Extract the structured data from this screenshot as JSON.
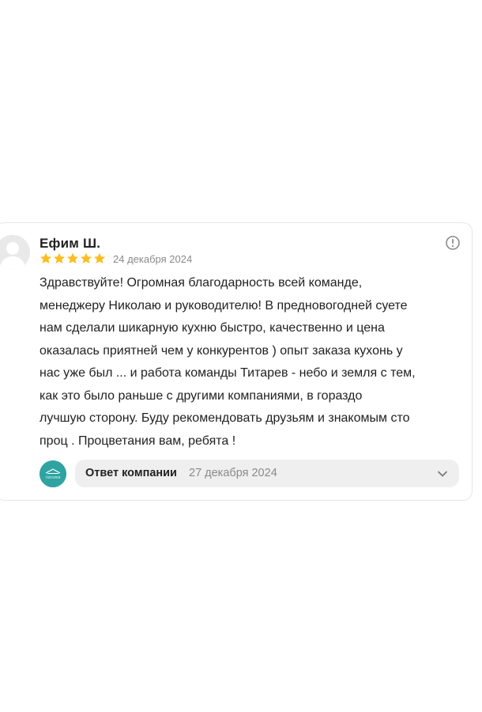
{
  "review": {
    "author": "Ефим Ш.",
    "rating": 5,
    "max_rating": 5,
    "date": "24 декабря 2024",
    "text_lines": [
      "Здравствуйте! Огромная благодарность всей команде,",
      "менеджеру Николаю и руководителю! В предновогодней суете",
      "нам сделали шикарную кухню быстро, качественно и цена",
      "оказалась приятней чем у конкурентов ) опыт заказа кухонь у",
      "нас уже был ... и работа команды Титарев - небо и земля с тем,",
      "как это было раньше с другими компаниями, в гораздо",
      "лучшую сторону. Буду рекомендовать друзьям и знакомым сто",
      "проц . Процветания вам, ребята !"
    ]
  },
  "reply": {
    "label": "Ответ компании",
    "date": "27 декабря 2024",
    "logo_text": "ТИТАРЕВ"
  },
  "colors": {
    "star": "#fbbd20",
    "logo": "#2fa3a2",
    "muted": "#8a8a8a",
    "reply_bg": "#efefef"
  },
  "icons": {
    "info": "info-circle-icon",
    "expand": "chevron-down-icon",
    "avatar": "user-placeholder-icon",
    "star": "star-icon"
  }
}
